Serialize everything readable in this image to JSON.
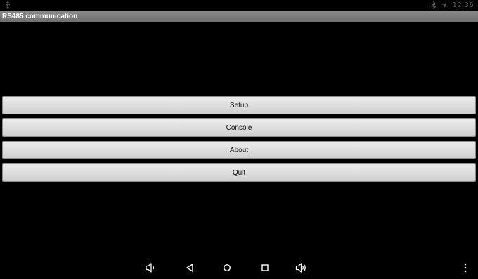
{
  "status_bar": {
    "left_icon": "usb-icon",
    "icons": [
      "bluetooth-icon",
      "data-transfer-icon"
    ],
    "time": "12:36"
  },
  "app": {
    "title": "RS485 communication"
  },
  "menu": {
    "buttons": [
      {
        "label": "Setup"
      },
      {
        "label": "Console"
      },
      {
        "label": "About"
      },
      {
        "label": "Quit"
      }
    ]
  },
  "nav_bar": {
    "icons": [
      "volume-down-icon",
      "back-icon",
      "home-icon",
      "recent-apps-icon",
      "volume-up-icon",
      "overflow-menu-icon"
    ]
  },
  "colors": {
    "background": "#000000",
    "title_bar": "#7d7d7d",
    "button_face": "#e0e0e0",
    "nav_icon": "#ffffff",
    "status_icon": "#5a5a5a"
  }
}
